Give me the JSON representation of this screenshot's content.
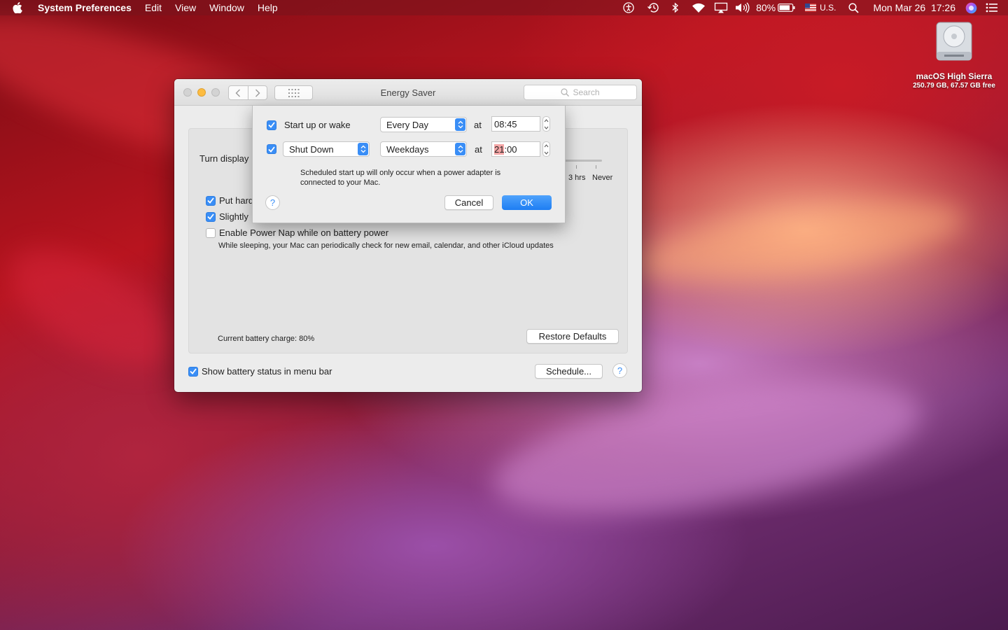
{
  "menubar": {
    "apple_icon": "apple-logo-icon",
    "items": [
      "System Preferences",
      "Edit",
      "View",
      "Window",
      "Help"
    ],
    "battery_percent": "80%",
    "input_source": "U.S.",
    "datetime": "Mon Mar 26  17:26",
    "status_icons": [
      "accessibility-icon",
      "time-machine-icon",
      "bluetooth-icon",
      "wifi-icon",
      "airplay-icon",
      "volume-icon",
      "battery-icon",
      "flag-us-icon",
      "spotlight-icon",
      "siri-icon",
      "notification-center-icon"
    ]
  },
  "desktop": {
    "disk_name": "macOS High Sierra",
    "disk_info": "250.79 GB, 67.57 GB free"
  },
  "window": {
    "title": "Energy Saver",
    "search_placeholder": "Search",
    "turn_display_label": "Turn display",
    "slider_labels": {
      "three_hrs": "3 hrs",
      "never": "Never"
    },
    "options": {
      "put_hard": {
        "label": "Put hard",
        "checked": true
      },
      "slightly": {
        "label": "Slightly",
        "checked": true
      },
      "power_nap": {
        "label": "Enable Power Nap while on battery power",
        "checked": false
      }
    },
    "power_nap_desc": "While sleeping, your Mac can periodically check for new email, calendar, and other iCloud updates",
    "battery_charge": "Current battery charge: 80%",
    "restore_defaults": "Restore Defaults",
    "show_battery_status": {
      "label": "Show battery status in menu bar",
      "checked": true
    },
    "schedule_button": "Schedule...",
    "help": "?"
  },
  "sheet": {
    "startup_label": "Start up or wake",
    "startup_checked": true,
    "startup_frequency": "Every Day",
    "at_label": "at",
    "startup_time": "08:45",
    "shutdown_checked": true,
    "shutdown_action": "Shut Down",
    "shutdown_frequency": "Weekdays",
    "shutdown_time_hours": "21",
    "shutdown_time_rest": ":00",
    "note_line1": "Scheduled start up will only occur when a power adapter is",
    "note_line2": "connected to your Mac.",
    "help": "?",
    "cancel": "Cancel",
    "ok": "OK"
  },
  "colors": {
    "accent": "#3a8ef6",
    "minimize": "#fdbc40",
    "time_highlight": "#f4a6a6"
  }
}
